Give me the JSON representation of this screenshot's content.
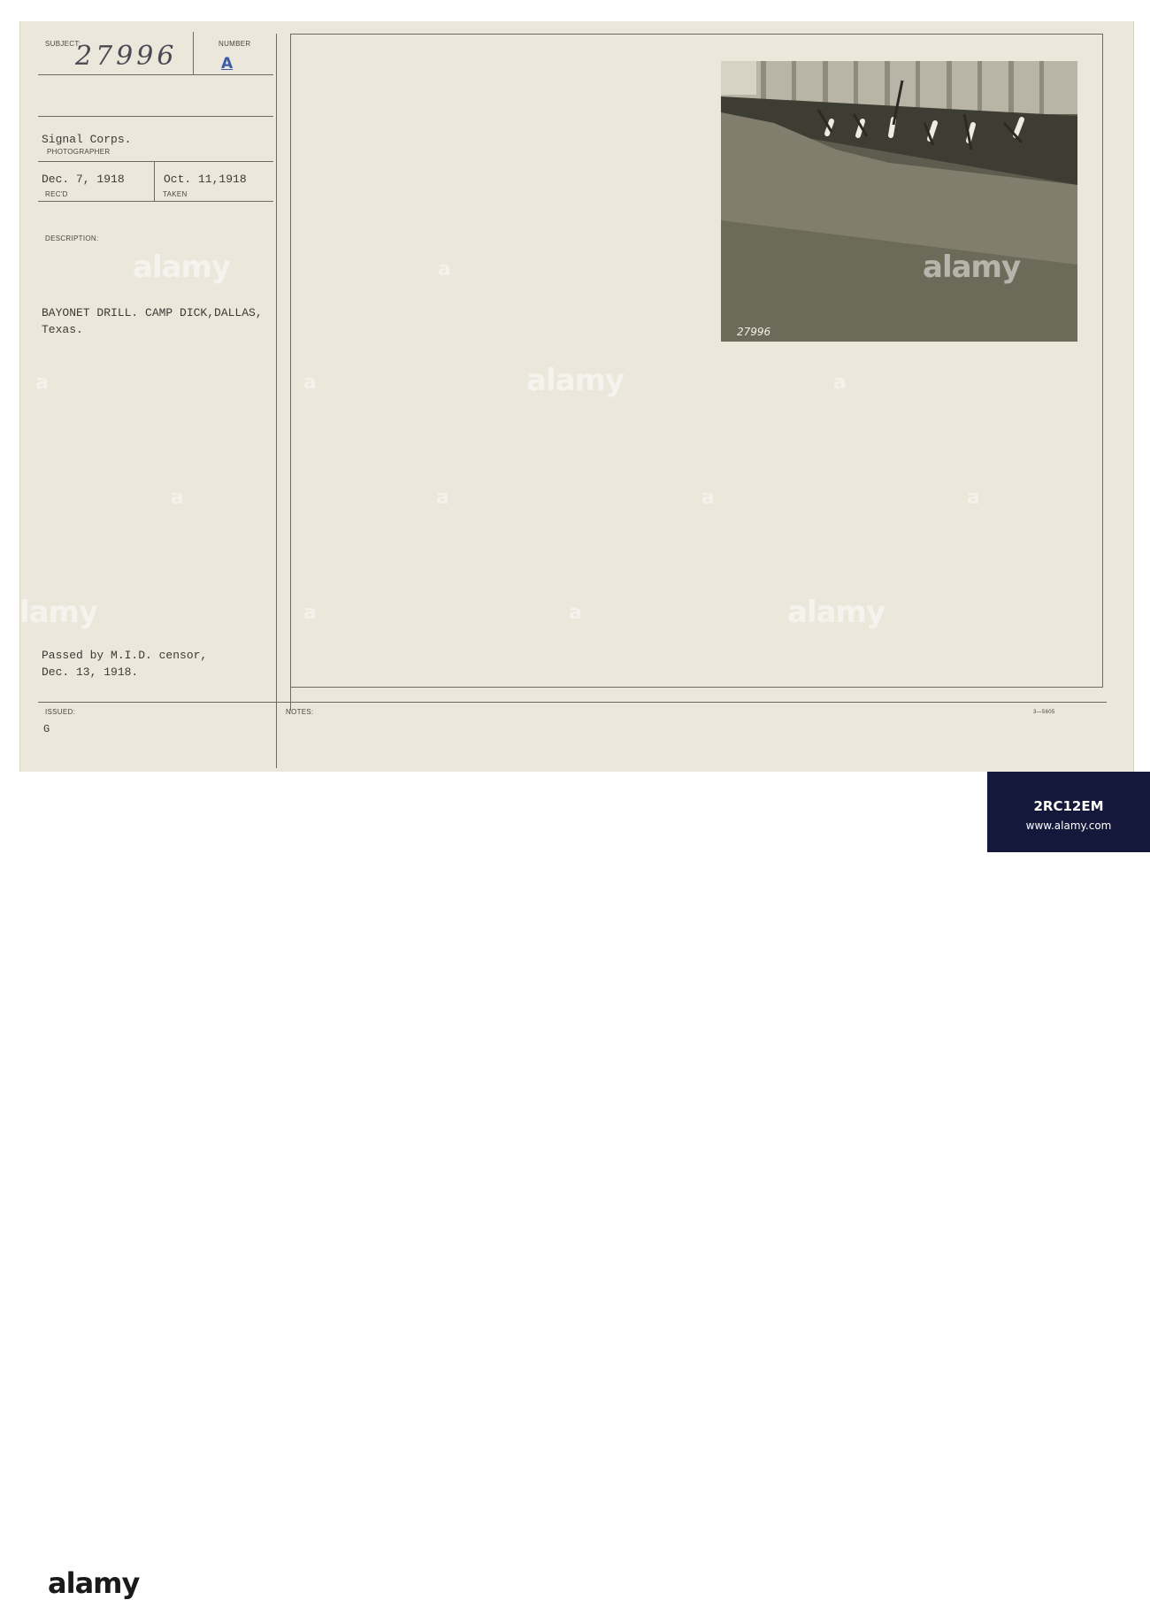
{
  "card": {
    "subject_label": "SUBJECT:",
    "subject_number": "27996",
    "number_label": "NUMBER",
    "number_value": "A",
    "photographer": "Signal Corps.",
    "photographer_label": "PHOTOGRAPHER",
    "received": "Dec. 7, 1918",
    "received_label": "REC'D",
    "taken": "Oct. 11,1918",
    "taken_label": "TAKEN",
    "description_label": "DESCRIPTION:",
    "description_line1": "BAYONET DRILL. CAMP DICK,DALLAS,",
    "description_line2": "Texas.",
    "censor_line1": "Passed by M.I.D. censor,",
    "censor_line2": "Dec. 13, 1918.",
    "issued_label": "ISSUED:",
    "issued_value": "G",
    "notes_label": "NOTES:",
    "form_code": "3—5605"
  },
  "photo": {
    "inscription": "27996"
  },
  "watermark": {
    "text": "alamy",
    "short": "a"
  },
  "footer": {
    "logo": "alamy",
    "image_id": "2RC12EM",
    "site": "www.alamy.com"
  },
  "colors": {
    "card": "#ece7db",
    "rules": "#6f6a60",
    "stamp_blue": "#3b5aa8",
    "footer_band": "#14193b"
  }
}
